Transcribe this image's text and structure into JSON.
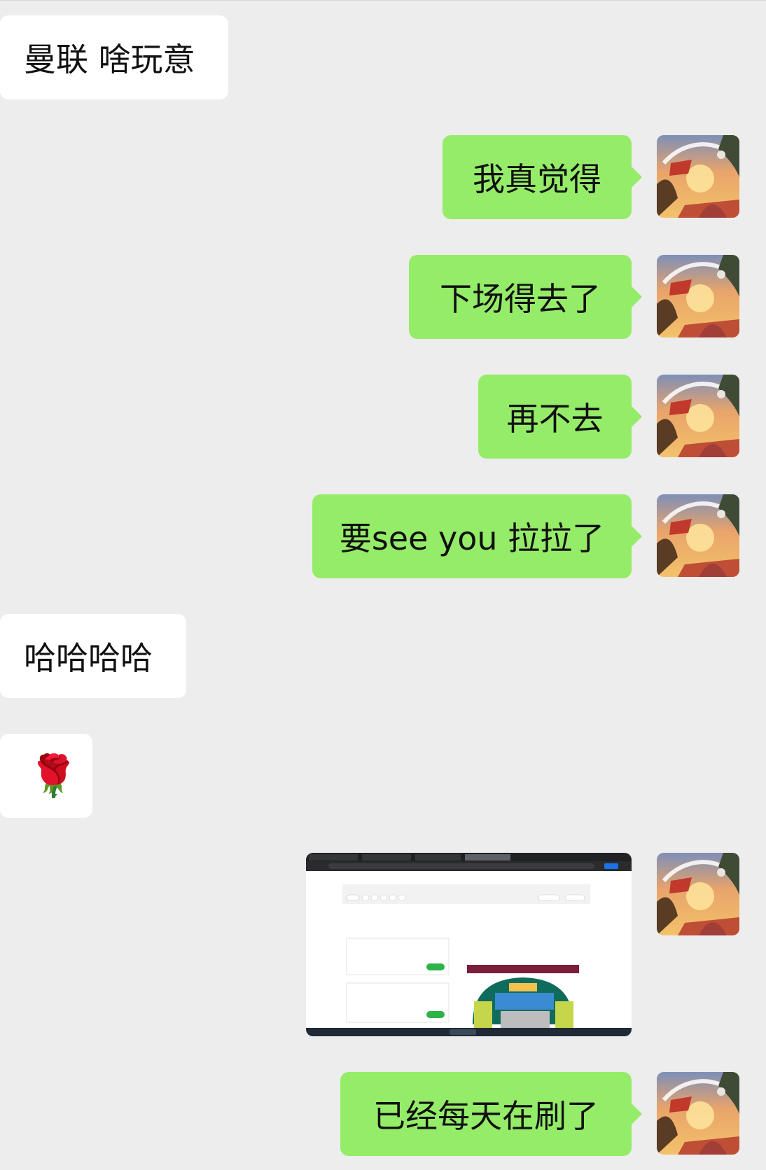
{
  "messages": [
    {
      "side": "in",
      "text": "曼联 啥玩意"
    },
    {
      "side": "out",
      "text": "我真觉得"
    },
    {
      "side": "out",
      "text": "下场得去了"
    },
    {
      "side": "out",
      "text": "再不去"
    },
    {
      "side": "out",
      "text": "要see you 拉拉了"
    },
    {
      "side": "in",
      "text": "哈哈哈哈"
    },
    {
      "side": "in",
      "emoji": "🌹"
    },
    {
      "side": "out",
      "image": "screenshot-ticket-site"
    },
    {
      "side": "out",
      "text": "已经每天在刷了"
    }
  ],
  "colors": {
    "background": "#ededed",
    "incoming_bubble": "#ffffff",
    "outgoing_bubble": "#95ec69",
    "text": "#111111"
  },
  "icons": {
    "avatar": "sunset-adventure-avatar",
    "rose": "rose-emoji"
  }
}
